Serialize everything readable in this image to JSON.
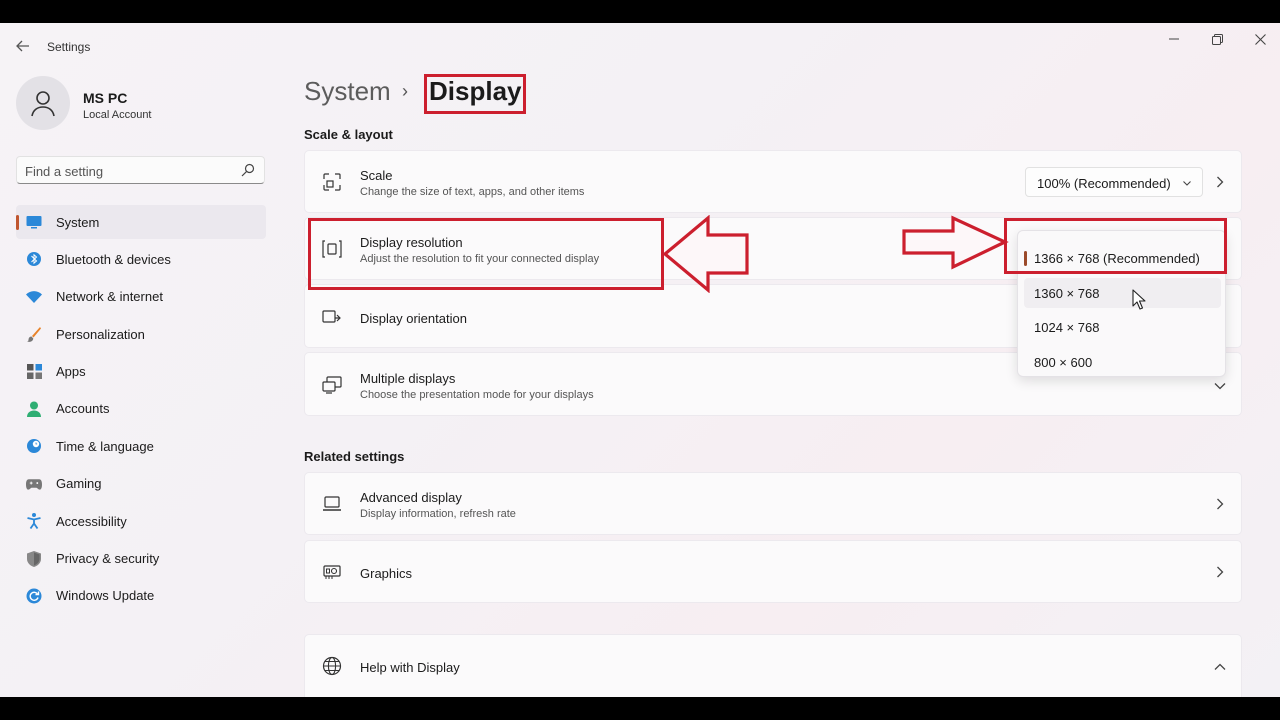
{
  "app": {
    "title": "Settings"
  },
  "window_controls": {
    "minimize": "—",
    "maximize": "❐",
    "close": "✕"
  },
  "user": {
    "name": "MS PC",
    "account_type": "Local Account"
  },
  "search": {
    "placeholder": "Find a setting"
  },
  "sidebar": {
    "items": [
      {
        "label": "System",
        "icon": "monitor-icon",
        "active": true
      },
      {
        "label": "Bluetooth & devices",
        "icon": "bluetooth-icon"
      },
      {
        "label": "Network & internet",
        "icon": "wifi-icon"
      },
      {
        "label": "Personalization",
        "icon": "brush-icon"
      },
      {
        "label": "Apps",
        "icon": "apps-icon"
      },
      {
        "label": "Accounts",
        "icon": "person-icon"
      },
      {
        "label": "Time & language",
        "icon": "clock-globe-icon"
      },
      {
        "label": "Gaming",
        "icon": "gamepad-icon"
      },
      {
        "label": "Accessibility",
        "icon": "accessibility-icon"
      },
      {
        "label": "Privacy & security",
        "icon": "shield-icon"
      },
      {
        "label": "Windows Update",
        "icon": "update-icon"
      }
    ]
  },
  "breadcrumb": {
    "parent": "System",
    "separator": "›",
    "current": "Display"
  },
  "sections": {
    "scale_layout": "Scale & layout",
    "related": "Related settings"
  },
  "cards": {
    "scale": {
      "title": "Scale",
      "desc": "Change the size of text, apps, and other items",
      "value": "100% (Recommended)"
    },
    "resolution": {
      "title": "Display resolution",
      "desc": "Adjust the resolution to fit your connected display"
    },
    "orientation": {
      "title": "Display orientation"
    },
    "multiple": {
      "title": "Multiple displays",
      "desc": "Choose the presentation mode for your displays"
    },
    "advanced": {
      "title": "Advanced display",
      "desc": "Display information, refresh rate"
    },
    "graphics": {
      "title": "Graphics"
    },
    "help": {
      "title": "Help with Display"
    }
  },
  "resolution_options": {
    "selected": "1366 × 768 (Recommended)",
    "items": [
      "1366 × 768 (Recommended)",
      "1360 × 768",
      "1024 × 768",
      "800 × 600"
    ]
  },
  "colors": {
    "accent": "#c0562f",
    "highlight": "#cc1f2e"
  }
}
